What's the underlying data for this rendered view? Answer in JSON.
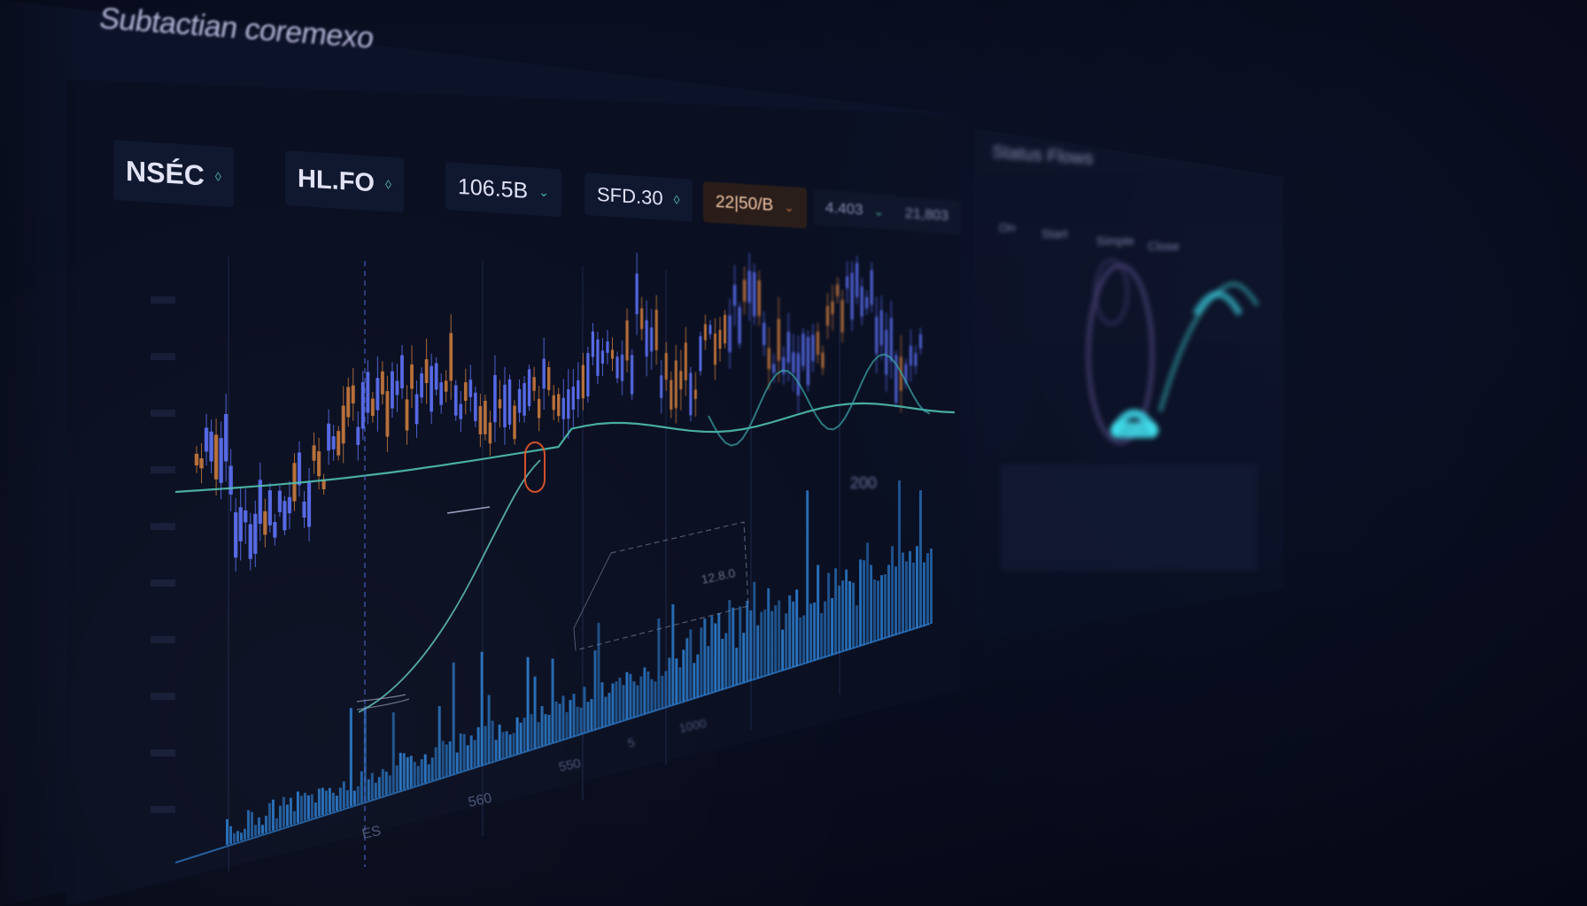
{
  "app": {
    "title": "Subtactian coremexo"
  },
  "tickers": [
    {
      "label": "NSÉC",
      "chevron": "◊"
    },
    {
      "label": "HL.FO",
      "chevron": "◊"
    },
    {
      "label": "106.5B",
      "chevron": "⌄"
    },
    {
      "label": "SFD.30",
      "chevron": "◊"
    },
    {
      "label": "22|50/B",
      "chevron": "⌄",
      "accent": true
    },
    {
      "label": "4.403",
      "chevron": "⌄",
      "faint": true
    },
    {
      "label": "21,803",
      "chevron": "",
      "faint": true
    }
  ],
  "chart": {
    "annotation_label": "12.8.0",
    "marker_label": "200",
    "x_ticks": [
      "ES",
      "560",
      "550",
      "5",
      "1000"
    ]
  },
  "side_panel": {
    "title": "Status Flows",
    "tabs": [
      "On",
      "Start",
      "Simple",
      "Close"
    ]
  },
  "colors": {
    "background": "#070b19",
    "panel": "#0a0f21",
    "candle_up": "#5a6ef0",
    "candle_down": "#c2763b",
    "moving_average": "#4fbfae",
    "volume": "#2d7fd2",
    "highlight_ring": "#e8582a",
    "gauge": "#3ee0ee"
  },
  "icons": {
    "ticker_chevron": "chevron-down-icon"
  }
}
